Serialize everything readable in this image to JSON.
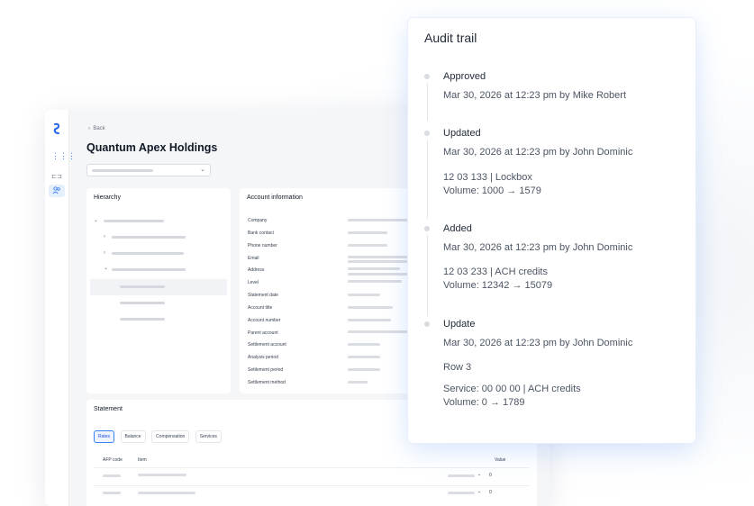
{
  "app": {
    "back_label": "Back",
    "page_title": "Quantum Apex Holdings",
    "hierarchy_title": "Hierarchy",
    "account_info_title": "Account information",
    "account_fields": [
      "Company",
      "Bank contact",
      "Phone number",
      "Email",
      "Address",
      "Level",
      "Statement date",
      "Account title",
      "Account number",
      "Parent account",
      "Settlement account",
      "Analysis period",
      "Settlement period",
      "Settlement method"
    ],
    "statement": {
      "title": "Statement",
      "tabs": [
        "Rates",
        "Balance",
        "Compensation",
        "Services"
      ],
      "active_tab": "Rates",
      "columns": {
        "afp_code": "AFP code",
        "item": "Item",
        "value": "Value"
      },
      "row_values": [
        "0",
        "0"
      ]
    }
  },
  "audit": {
    "title": "Audit trail",
    "events": [
      {
        "title": "Approved",
        "meta": "Mar 30, 2026 at 12:23 pm by Mike Robert",
        "details": []
      },
      {
        "title": "Updated",
        "meta": "Mar 30, 2026 at 12:23 pm by John Dominic",
        "details": [
          "12 03 133 | Lockbox",
          "Volume: 1000 → 1579"
        ]
      },
      {
        "title": "Added",
        "meta": "Mar 30, 2026 at 12:23 pm by John Dominic",
        "details": [
          "12 03 233 | ACH credits",
          "Volume: 12342 → 15079"
        ]
      },
      {
        "title": "Update",
        "meta": "Mar 30, 2026 at 12:23 pm by John Dominic",
        "details": [
          "Row 3",
          "Service: 00 00 00 | ACH credits",
          "Volume: 0 → 1789"
        ]
      }
    ]
  }
}
